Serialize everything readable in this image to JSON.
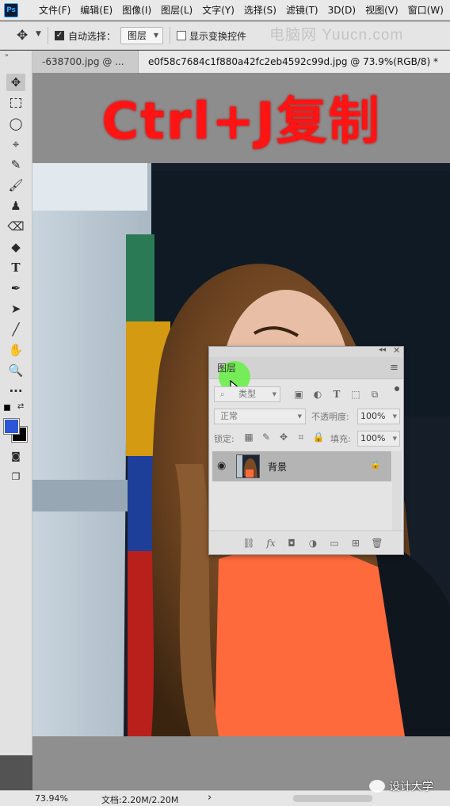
{
  "app_logo": "Ps",
  "menu": [
    "文件(F)",
    "编辑(E)",
    "图像(I)",
    "图层(L)",
    "文字(Y)",
    "选择(S)",
    "滤镜(T)",
    "3D(D)",
    "视图(V)",
    "窗口(W)"
  ],
  "options_bar": {
    "auto_select_label": "自动选择：",
    "auto_select_value": "图层",
    "transform_controls_label": "显示变换控件"
  },
  "watermark": "电脑网 Yuucn.com",
  "tabs": [
    {
      "label": "-638700.jpg @ ..."
    },
    {
      "label": "e0f58c7684c1f880a42fc2eb4592c99d.jpg @ 73.9%(RGB/8) *"
    }
  ],
  "headline": "Ctrl+J复制",
  "layers_panel": {
    "tab_label": "图层",
    "filter_placeholder": "类型",
    "blend_mode": "正常",
    "opacity_label": "不透明度:",
    "opacity_value": "100%",
    "lock_label": "锁定:",
    "fill_label": "填充:",
    "fill_value": "100%",
    "layers": [
      {
        "name": "背景",
        "visible": true,
        "locked": true
      }
    ]
  },
  "status_bar": {
    "zoom": "73.94%",
    "doc_info": "文档:2.20M/2.20M",
    "arrow": "›"
  },
  "attribution": "设计大学",
  "colors": {
    "foreground": "#2b56d9",
    "background": "#000000",
    "headline": "#ff1313",
    "cursor_highlight": "#6cf04a"
  }
}
